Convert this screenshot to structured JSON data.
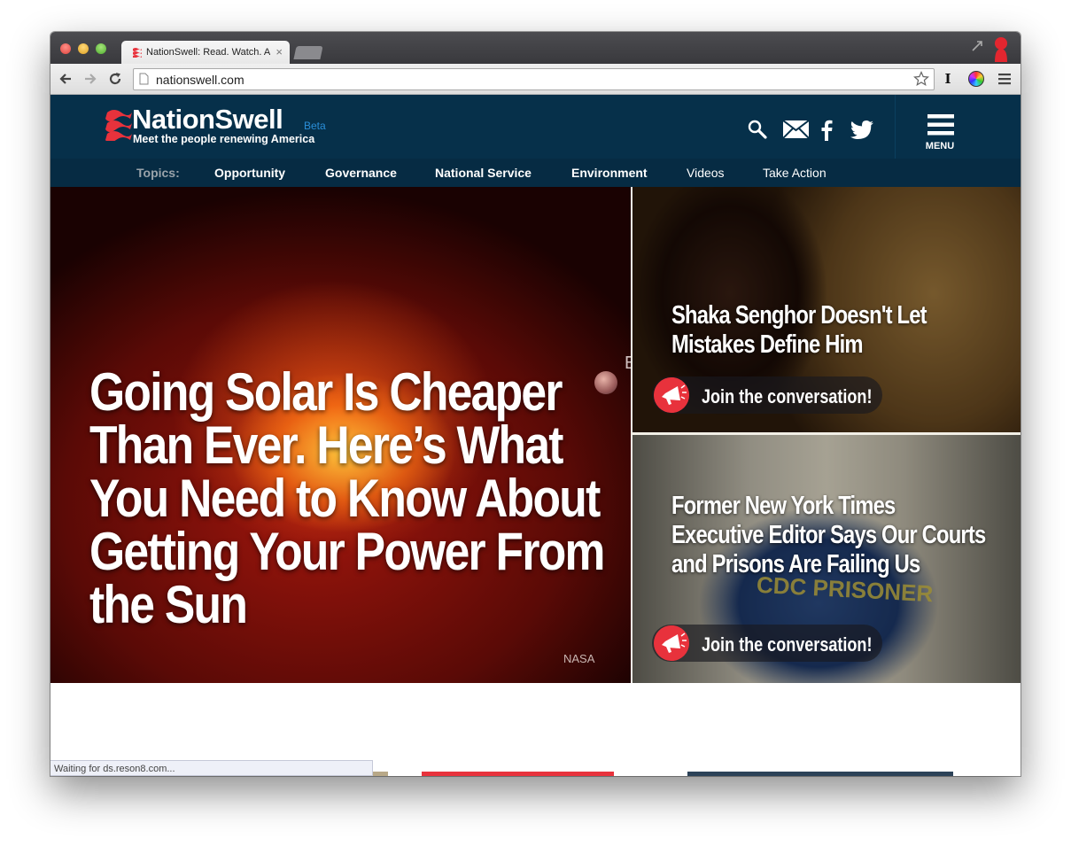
{
  "browser": {
    "tab_title": "NationSwell: Read. Watch. Act.",
    "tab_close": "×",
    "url": "nationswell.com",
    "extension_letter": "I",
    "status_text": "Waiting for ds.reson8.com..."
  },
  "header": {
    "logo_text": "NationSwell",
    "beta_label": "Beta",
    "tagline": "Meet the people renewing America",
    "menu_label": "MENU"
  },
  "topics": {
    "label": "Topics:",
    "items": [
      "Opportunity",
      "Governance",
      "National Service",
      "Environment",
      "Videos",
      "Take Action"
    ]
  },
  "hero": {
    "title": "Going Solar Is Cheaper Than Ever. Here’s What You Need to Know About Getting Your Power From the Sun",
    "credit": "NASA",
    "edge_char": "E"
  },
  "stories": [
    {
      "title": "Shaka Senghor Doesn't Let Mistakes Define Him",
      "cta": "Join the conversation!"
    },
    {
      "title": "Former New York Times Executive Editor Says Our Courts and Prisons Are Failing Us",
      "cta": "Join the conversation!",
      "image_text": "CDC PRISONER"
    }
  ],
  "colors": {
    "header_bg": "#06304a",
    "topics_bg": "#062b43",
    "brand_red": "#e8323c",
    "beta_blue": "#2a8ed8"
  }
}
